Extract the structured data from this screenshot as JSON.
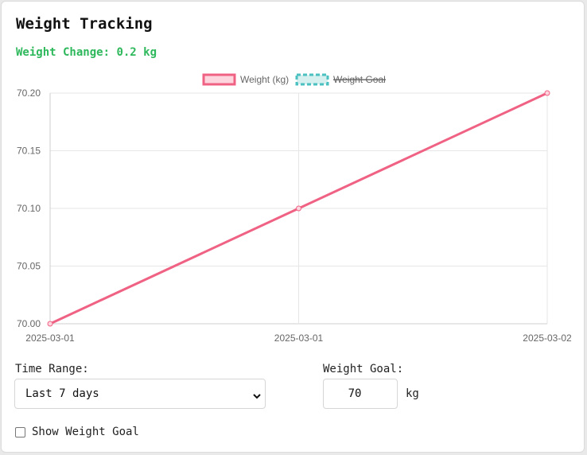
{
  "card": {
    "title": "Weight Tracking",
    "change_label": "Weight Change:",
    "change_value": "0.2 kg"
  },
  "colors": {
    "weight_line": "#f06284",
    "goal_line": "#4bc0c0",
    "change_text": "#2eb85c"
  },
  "chart_data": {
    "type": "line",
    "categories": [
      "2025-03-01",
      "2025-03-01",
      "2025-03-02"
    ],
    "series": [
      {
        "name": "Weight (kg)",
        "values": [
          70.0,
          70.1,
          70.2
        ],
        "color": "#f06284"
      },
      {
        "name": "Weight Goal",
        "values": [
          70,
          70,
          70
        ],
        "color": "#4bc0c0",
        "hidden": true
      }
    ],
    "yticks": [
      "70.00",
      "70.05",
      "70.10",
      "70.15",
      "70.20"
    ],
    "ylim": [
      70.0,
      70.2
    ],
    "grid": true,
    "legend": "top-center"
  },
  "controls": {
    "time_range_label": "Time Range:",
    "time_range_value": "Last 7 days",
    "weight_goal_label": "Weight Goal:",
    "weight_goal_value": "70",
    "weight_goal_unit": "kg",
    "show_goal_label": "Show Weight Goal",
    "show_goal_checked": false
  }
}
